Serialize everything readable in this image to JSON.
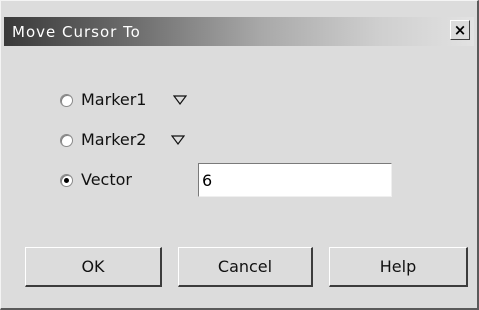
{
  "dialog": {
    "title": "Move Cursor To",
    "close_glyph": "×"
  },
  "options": [
    {
      "label": "Marker1",
      "selected": false,
      "has_dropdown": true
    },
    {
      "label": "Marker2",
      "selected": false,
      "has_dropdown": true
    },
    {
      "label": "Vector",
      "selected": true,
      "has_dropdown": false
    }
  ],
  "vector_input": {
    "value": "6"
  },
  "buttons": {
    "ok": "OK",
    "cancel": "Cancel",
    "help": "Help"
  },
  "icons": {
    "close": "close-icon",
    "dropdown": "triangle-down-icon",
    "radio": "radio-icon"
  }
}
